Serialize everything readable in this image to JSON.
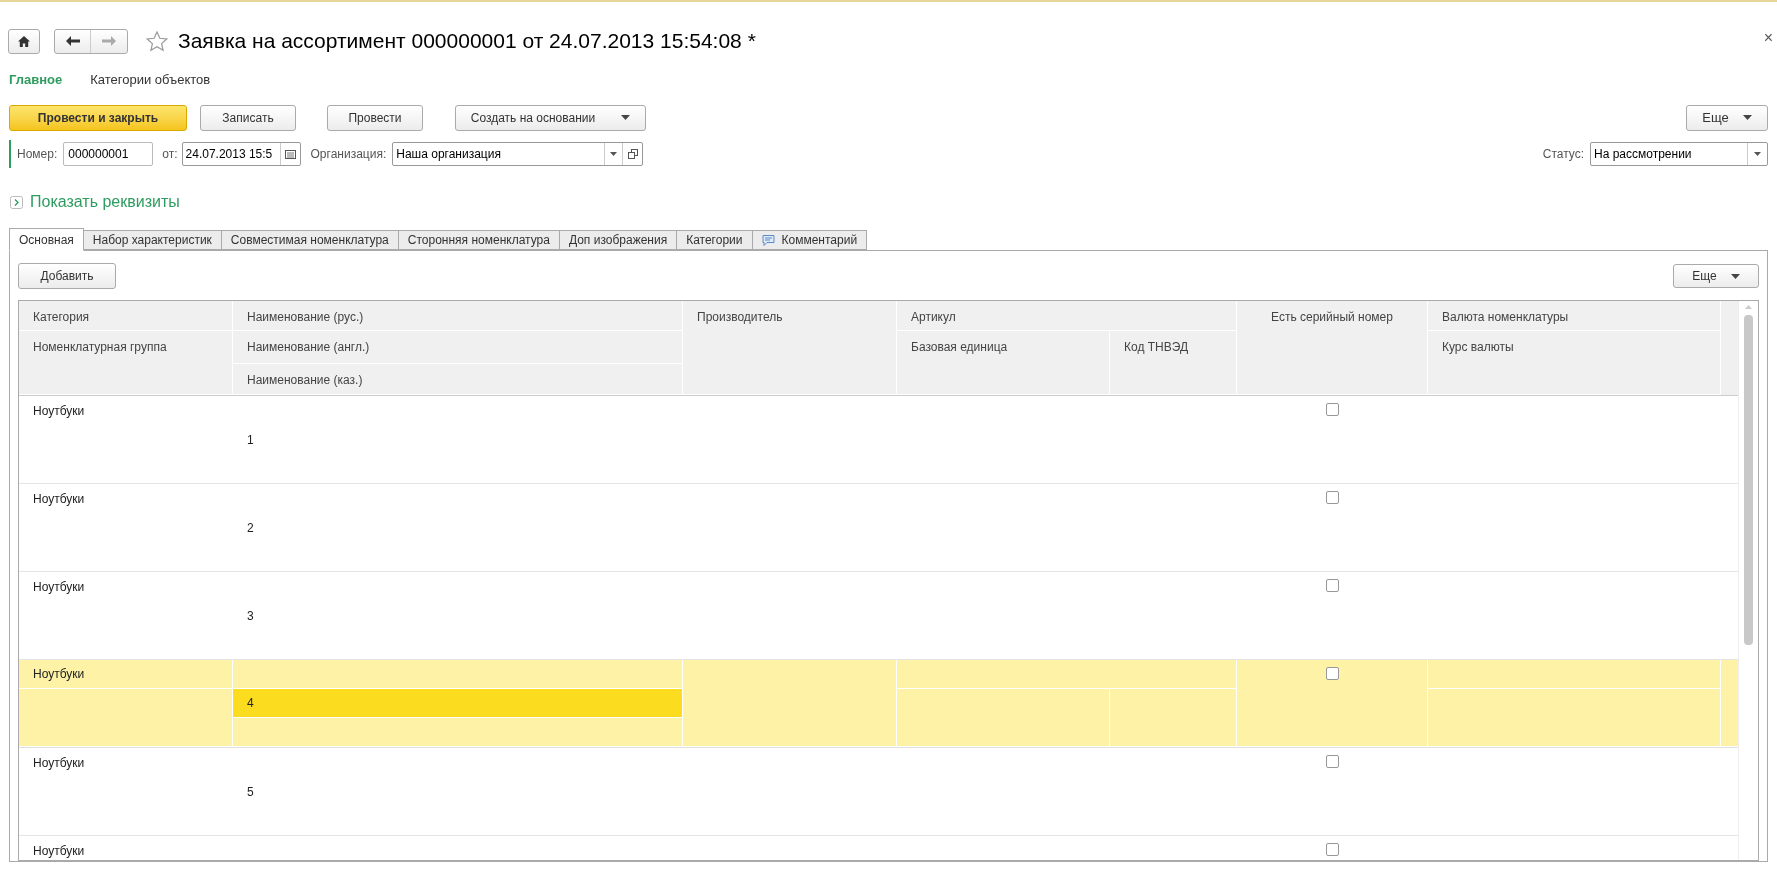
{
  "window": {
    "title": "Заявка на ассортимент 000000001 от 24.07.2013 15:54:08 *",
    "close": "×"
  },
  "section_tabs": [
    {
      "label": "Главное",
      "selected": true
    },
    {
      "label": "Категории объектов",
      "selected": false
    }
  ],
  "command_bar": {
    "buttons": [
      {
        "label": "Провести и закрыть",
        "kind": "primary"
      },
      {
        "label": "Записать",
        "kind": "plain"
      },
      {
        "label": "Провести",
        "kind": "plain"
      },
      {
        "label": "Создать на основании",
        "kind": "dropdown"
      }
    ],
    "more": "Еще"
  },
  "fields": {
    "number_label": "Номер:",
    "number": "000000001",
    "date_label": "от:",
    "date": "24.07.2013 15:5",
    "org_label": "Организация:",
    "org": "Наша организация",
    "status_label": "Статус:",
    "status": "На рассмотрении"
  },
  "show_details": "Показать реквизиты",
  "tabs": [
    {
      "label": "Основная",
      "selected": true,
      "kind": "text"
    },
    {
      "label": "Набор характеристик",
      "selected": false,
      "kind": "text"
    },
    {
      "label": "Совместимая номенклатура",
      "selected": false,
      "kind": "text"
    },
    {
      "label": "Сторонняя номенклатура",
      "selected": false,
      "kind": "text"
    },
    {
      "label": "Доп изображения",
      "selected": false,
      "kind": "text"
    },
    {
      "label": "Категории",
      "selected": false,
      "kind": "text"
    },
    {
      "label": "Комментарий",
      "selected": false,
      "kind": "comment"
    }
  ],
  "table_bar": {
    "add": "Добавить",
    "more": "Еще"
  },
  "table": {
    "columns": {
      "category": "Категория",
      "group": "Номенклатурная группа",
      "name_rus": "Наименование (рус.)",
      "name_eng": "Наименование (англ.)",
      "name_kaz": "Наименование (каз.)",
      "maker": "Производитель",
      "article": "Артикул",
      "unit": "Базовая единица",
      "tnved": "Код ТНВЭД",
      "serial": "Есть серийный номер",
      "currency": "Валюта номенклатуры",
      "rate": "Курс валюты"
    },
    "rows": [
      {
        "category": "Ноутбуки",
        "name_eng": "1",
        "serial": false,
        "selected": false
      },
      {
        "category": "Ноутбуки",
        "name_eng": "2",
        "serial": false,
        "selected": false
      },
      {
        "category": "Ноутбуки",
        "name_eng": "3",
        "serial": false,
        "selected": false
      },
      {
        "category": "Ноутбуки",
        "name_eng": "4",
        "serial": false,
        "selected": true
      },
      {
        "category": "Ноутбуки",
        "name_eng": "5",
        "serial": false,
        "selected": false
      },
      {
        "category": "Ноутбуки",
        "serial": false,
        "selected": false
      }
    ]
  }
}
